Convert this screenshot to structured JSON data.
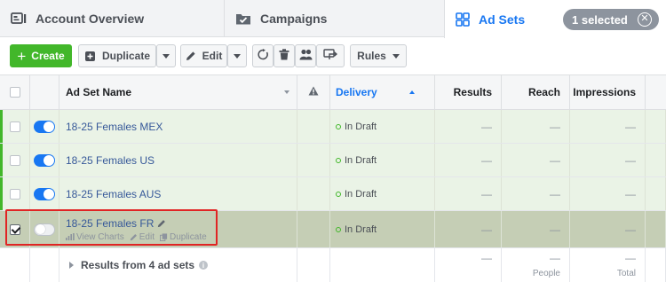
{
  "tabs": {
    "account": "Account Overview",
    "campaigns": "Campaigns",
    "adsets": "Ad Sets",
    "selected_pill": "1 selected"
  },
  "toolbar": {
    "create": "Create",
    "duplicate": "Duplicate",
    "edit": "Edit",
    "rules": "Rules"
  },
  "columns": {
    "name": "Ad Set Name",
    "delivery": "Delivery",
    "results": "Results",
    "reach": "Reach",
    "impressions": "Impressions"
  },
  "rows": [
    {
      "name": "18-25 Females MEX",
      "delivery": "In Draft",
      "results": "—",
      "reach": "—",
      "impressions": "—",
      "active": true
    },
    {
      "name": "18-25 Females US",
      "delivery": "In Draft",
      "results": "—",
      "reach": "—",
      "impressions": "—",
      "active": true
    },
    {
      "name": "18-25 Females AUS",
      "delivery": "In Draft",
      "results": "—",
      "reach": "—",
      "impressions": "—",
      "active": true
    },
    {
      "name": "18-25 Females FR",
      "delivery": "In Draft",
      "results": "—",
      "reach": "—",
      "impressions": "—",
      "active": false,
      "selected": true,
      "actions": {
        "view_charts": "View Charts",
        "edit": "Edit",
        "duplicate": "Duplicate"
      }
    }
  ],
  "summary": {
    "label": "Results from 4 ad sets",
    "results": "—",
    "reach": "—",
    "reach_sub": "People",
    "impressions": "—",
    "impressions_sub": "Total"
  },
  "colors": {
    "accent": "#1877f2",
    "create_green": "#42b72a",
    "draft_row": "#eaf3e6",
    "selected_row": "#c5ceb5",
    "highlight_outline": "#e02424"
  }
}
